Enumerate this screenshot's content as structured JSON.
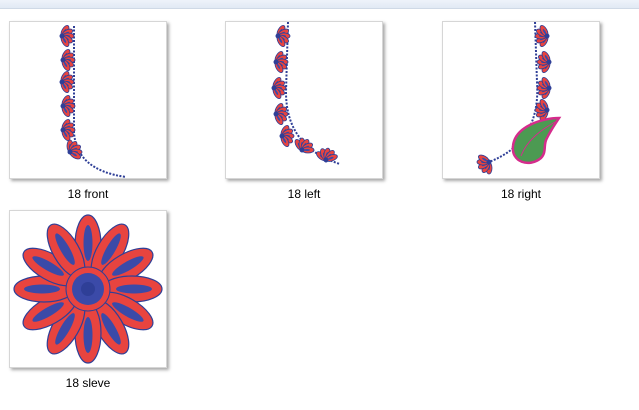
{
  "files": [
    {
      "name": "18 front",
      "thumbnail": "embroidery-neckline-front-icon"
    },
    {
      "name": "18 left",
      "thumbnail": "embroidery-neckline-left-icon"
    },
    {
      "name": "18 right",
      "thumbnail": "embroidery-neckline-right-icon"
    },
    {
      "name": "18 sleve",
      "thumbnail": "embroidery-flower-sleeve-icon"
    }
  ],
  "colors": {
    "petal_red": "#e8443f",
    "petal_blue": "#3b4aa8",
    "stitch_blue": "#2f3f97",
    "leaf_green": "#4c9a52",
    "leaf_border": "#d52c8c"
  }
}
